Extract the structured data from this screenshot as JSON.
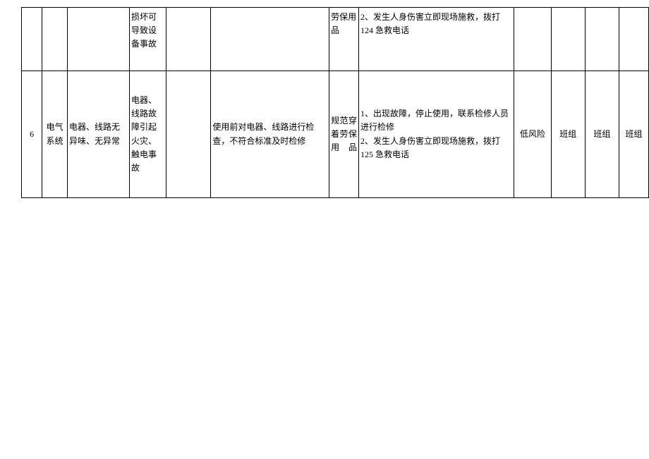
{
  "rows": [
    {
      "c0": "",
      "c1": "",
      "c2": "",
      "c3": "损坏可导致设备事故",
      "c4": "",
      "c5": "",
      "c6": "劳保用品",
      "c7": "2、发生人身伤害立即现场施救，拨打 124 急救电话",
      "c8": "",
      "c9": "",
      "c10": "",
      "c11": ""
    },
    {
      "c0": "6",
      "c1": "电气系统",
      "c2": "电器、线路无异味、无异常",
      "c3": "电器、线路故障引起火灾、触电事故",
      "c4": "",
      "c5": "使用前对电器、线路进行检查，不符合标准及时检修",
      "c6": "规范穿着劳保用品",
      "c7": "1、出现故障，停止使用，联系检修人员进行检修\n2、发生人身伤害立即现场施救，拨打 125 急救电话",
      "c8": "低风险",
      "c9": "班组",
      "c10": "班组",
      "c11": "班组"
    }
  ]
}
